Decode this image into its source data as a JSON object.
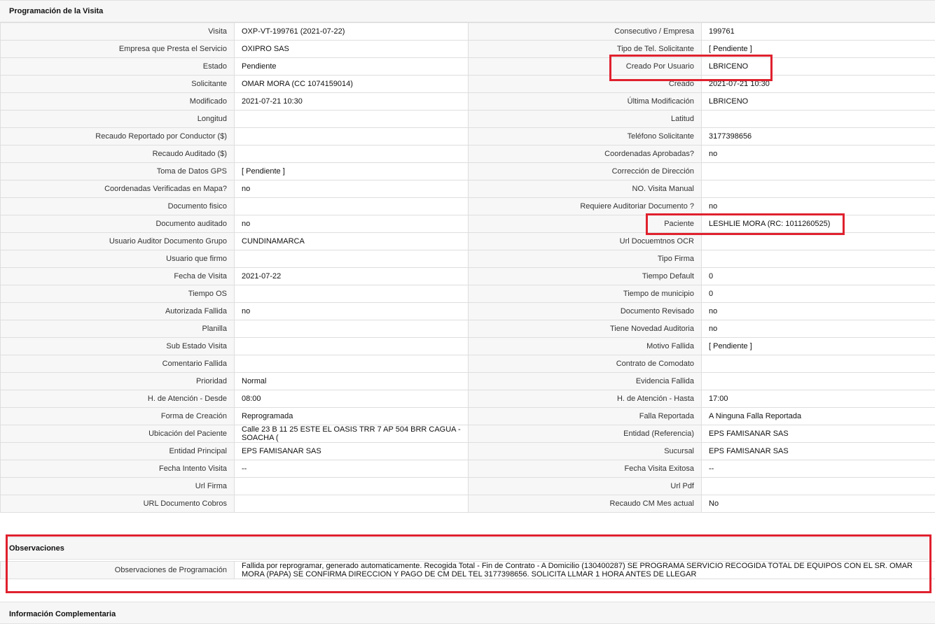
{
  "sections": {
    "programacion": "Programación de la Visita",
    "observaciones": "Observaciones",
    "complementaria": "Información Complementaria"
  },
  "rows": [
    {
      "l1": "Visita",
      "v1": "OXP-VT-199761 (2021-07-22)",
      "l2": "Consecutivo / Empresa",
      "v2": "199761"
    },
    {
      "l1": "Empresa que Presta el Servicio",
      "v1": "OXIPRO SAS",
      "l2": "Tipo de Tel. Solicitante",
      "v2": "[ Pendiente ]"
    },
    {
      "l1": "Estado",
      "v1": "Pendiente",
      "l2": "Creado Por Usuario",
      "v2": "LBRICENO"
    },
    {
      "l1": "Solicitante",
      "v1": "OMAR MORA (CC 1074159014)",
      "l2": "Creado",
      "v2": "2021-07-21 10:30"
    },
    {
      "l1": "Modificado",
      "v1": "2021-07-21 10:30",
      "l2": "Última Modificación",
      "v2": " LBRICENO"
    },
    {
      "l1": "Longitud",
      "v1": "",
      "l2": "Latitud",
      "v2": ""
    },
    {
      "l1": "Recaudo Reportado por Conductor ($)",
      "v1": "",
      "l2": "Teléfono Solicitante",
      "v2": "3177398656"
    },
    {
      "l1": "Recaudo Auditado ($)",
      "v1": "",
      "l2": "Coordenadas Aprobadas?",
      "v2": " no"
    },
    {
      "l1": "Toma de Datos GPS",
      "v1": "[ Pendiente ]",
      "l2": "Corrección de Dirección",
      "v2": ""
    },
    {
      "l1": "Coordenadas Verificadas en Mapa?",
      "v1": " no",
      "l2": "NO. Visita Manual",
      "v2": ""
    },
    {
      "l1": "Documento fisico",
      "v1": "",
      "l2": "Requiere Auditoriar Documento ?",
      "v2": " no"
    },
    {
      "l1": "Documento auditado",
      "v1": " no",
      "l2": "Paciente",
      "v2": "LESHLIE MORA (RC: 1011260525)"
    },
    {
      "l1": "Usuario Auditor Documento Grupo",
      "v1": "CUNDINAMARCA",
      "l2": "Url Docuemtnos OCR",
      "v2": ""
    },
    {
      "l1": "Usuario que firmo",
      "v1": "",
      "l2": "Tipo Firma",
      "v2": ""
    },
    {
      "l1": "Fecha de Visita",
      "v1": " 2021-07-22",
      "l2": "Tiempo Default",
      "v2": " 0"
    },
    {
      "l1": "Tiempo OS",
      "v1": "",
      "l2": "Tiempo de municipio",
      "v2": " 0"
    },
    {
      "l1": "Autorizada Fallida",
      "v1": " no",
      "l2": "Documento Revisado",
      "v2": " no"
    },
    {
      "l1": "Planilla",
      "v1": "",
      "l2": "Tiene Novedad Auditoria",
      "v2": " no"
    },
    {
      "l1": "Sub Estado Visita",
      "v1": "",
      "l2": "Motivo Fallida",
      "v2": "[ Pendiente ]"
    },
    {
      "l1": "Comentario Fallida",
      "v1": "",
      "l2": "Contrato de Comodato",
      "v2": ""
    },
    {
      "l1": "Prioridad",
      "v1": "Normal",
      "l2": "Evidencia Fallida",
      "v2": ""
    },
    {
      "l1": "H. de Atención - Desde",
      "v1": "08:00",
      "l2": "H. de Atención - Hasta",
      "v2": "17:00"
    },
    {
      "l1": "Forma de Creación",
      "v1": "Reprogramada",
      "l2": "Falla Reportada",
      "v2": "A Ninguna Falla Reportada"
    },
    {
      "l1": "Ubicación del Paciente",
      "v1": "Calle 23 B 11 25 ESTE EL OASIS TRR 7 AP 504 BRR CAGUA - SOACHA (",
      "l2": "Entidad (Referencia)",
      "v2": "EPS FAMISANAR SAS"
    },
    {
      "l1": "Entidad Principal",
      "v1": "EPS FAMISANAR SAS",
      "l2": "Sucursal",
      "v2": "EPS FAMISANAR SAS"
    },
    {
      "l1": "Fecha Intento Visita",
      "v1": " --",
      "l2": "Fecha Visita Exitosa",
      "v2": " --"
    },
    {
      "l1": "Url Firma",
      "v1": "",
      "l2": "Url Pdf",
      "v2": ""
    },
    {
      "l1": "URL Documento Cobros",
      "v1": "",
      "l2": "Recaudo CM Mes actual",
      "v2": "No"
    }
  ],
  "observaciones": {
    "label": "Observaciones de Programación",
    "value": "  Fallida por reprogramar, generado automaticamente. Recogida Total - Fin de Contrato - A Domicilio (130400287) SE PROGRAMA SERVICIO RECOGIDA TOTAL DE EQUIPOS CON EL SR. OMAR MORA (PAPA) SE CONFIRMA DIRECCION Y PAGO DE CM DEL TEL 3177398656. SOLICITA LLMAR 1 HORA ANTES DE LLEGAR"
  },
  "colors": {
    "highlight": "#e0212e",
    "label_bg": "#f7f7f7",
    "border": "#dedede"
  }
}
